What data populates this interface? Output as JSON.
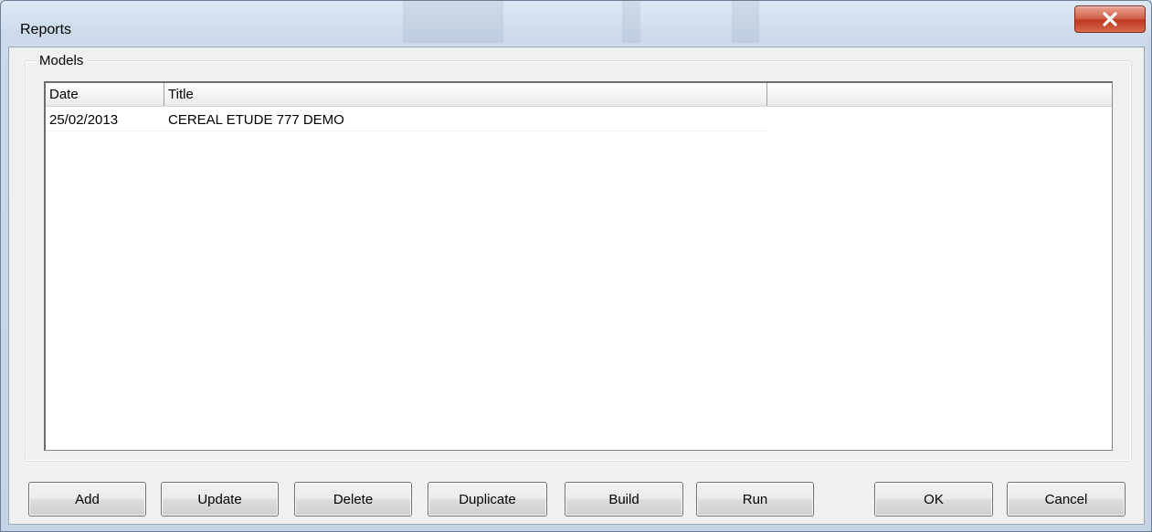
{
  "window": {
    "title": "Reports",
    "close_icon": "close-icon"
  },
  "models": {
    "group_label": "Models",
    "columns": [
      "Date",
      "Title"
    ],
    "rows": [
      {
        "date": "25/02/2013",
        "title": "CEREAL ETUDE 777 DEMO"
      }
    ]
  },
  "buttons": {
    "add": "Add",
    "update": "Update",
    "delete": "Delete",
    "duplicate": "Duplicate",
    "build": "Build",
    "run": "Run",
    "ok": "OK",
    "cancel": "Cancel"
  },
  "colors": {
    "close_button": "#c0391f",
    "dialog_face": "#f0f0f0",
    "frame": "#cbd9ea"
  }
}
